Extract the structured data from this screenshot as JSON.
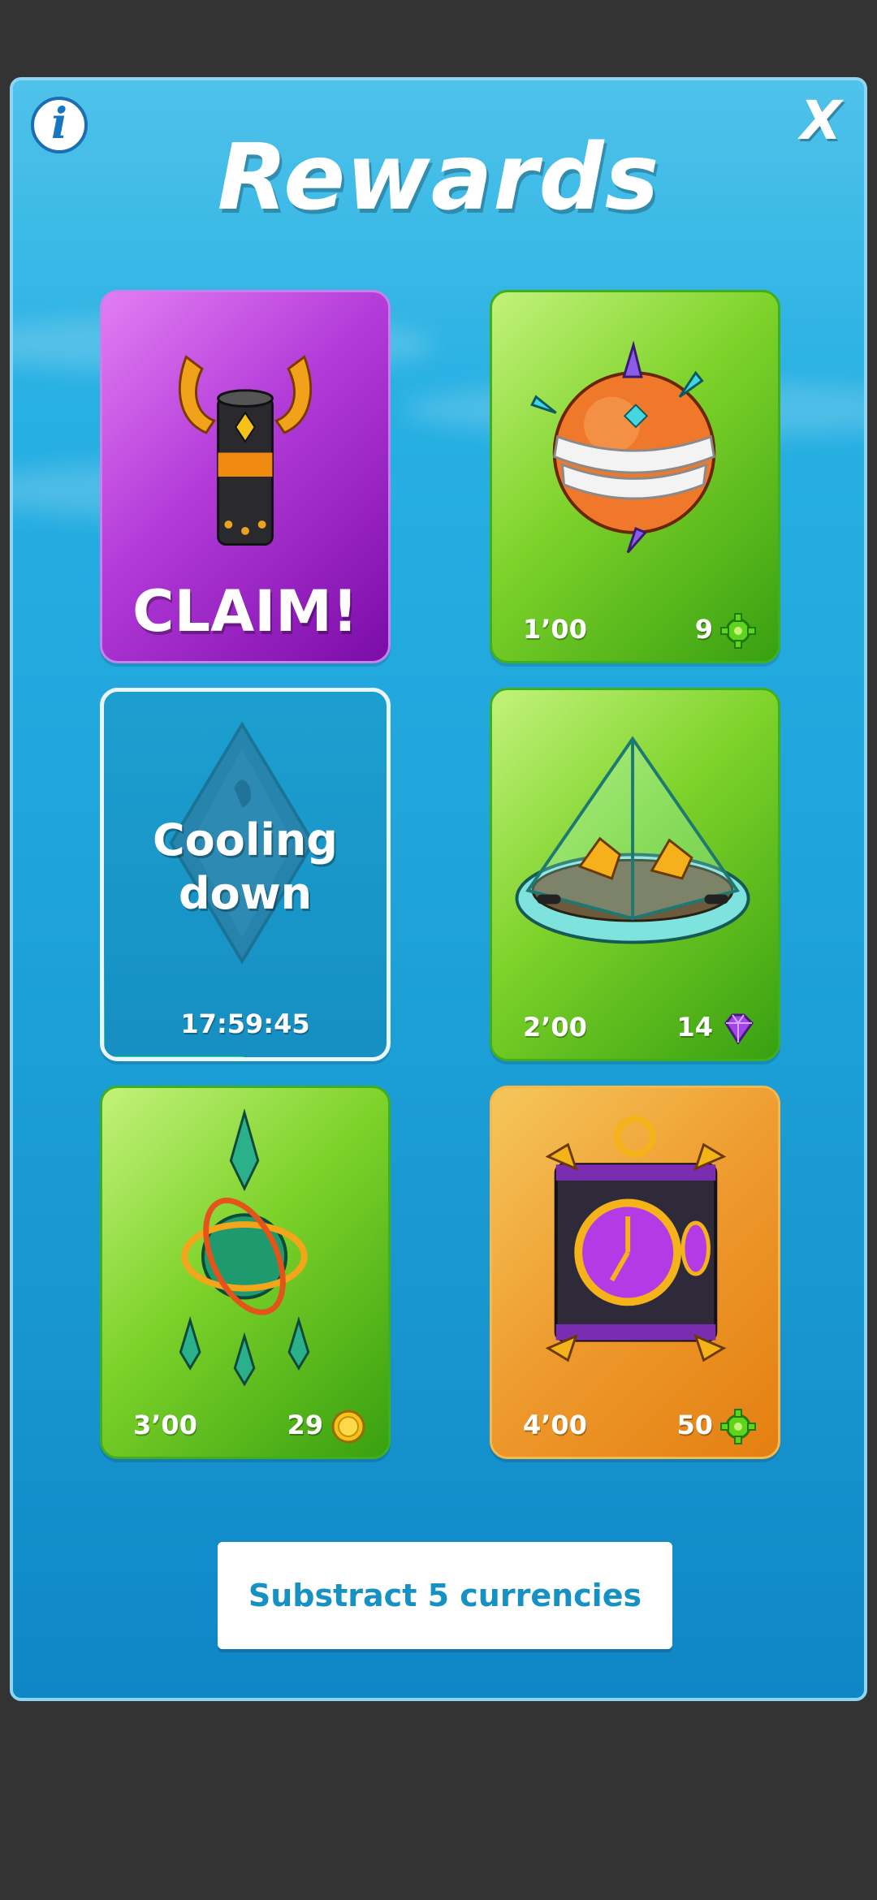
{
  "header": {
    "title": "Rewards",
    "info_icon": "info-icon",
    "info_glyph": "i",
    "close_icon": "close-icon",
    "close_glyph": "X"
  },
  "cards": [
    {
      "state": "claimable",
      "item_icon": "horned-cylinder-icon",
      "label": "CLAIM!",
      "color": "#b23ad8"
    },
    {
      "state": "available",
      "item_icon": "spiked-orb-icon",
      "time": "1’00",
      "count": "9",
      "currency_icon": "green-gear-icon",
      "color": "#7dd22a"
    },
    {
      "state": "cooling",
      "item_icon": "crystal-shield-icon",
      "label": "Cooling down",
      "timer": "17:59:45",
      "progress": 0.5,
      "color": "#168fc1"
    },
    {
      "state": "available",
      "item_icon": "pyramid-cage-icon",
      "time": "2’00",
      "count": "14",
      "currency_icon": "purple-gem-icon",
      "color": "#7dd22a"
    },
    {
      "state": "available",
      "item_icon": "armillary-sphere-icon",
      "time": "3’00",
      "count": "29",
      "currency_icon": "gold-coin-icon",
      "color": "#7dd22a"
    },
    {
      "state": "available",
      "item_icon": "clock-chest-icon",
      "time": "4’00",
      "count": "50",
      "currency_icon": "green-gear-icon",
      "color": "#ee9a2e"
    }
  ],
  "footer": {
    "button_label": "Substract 5 currencies"
  }
}
